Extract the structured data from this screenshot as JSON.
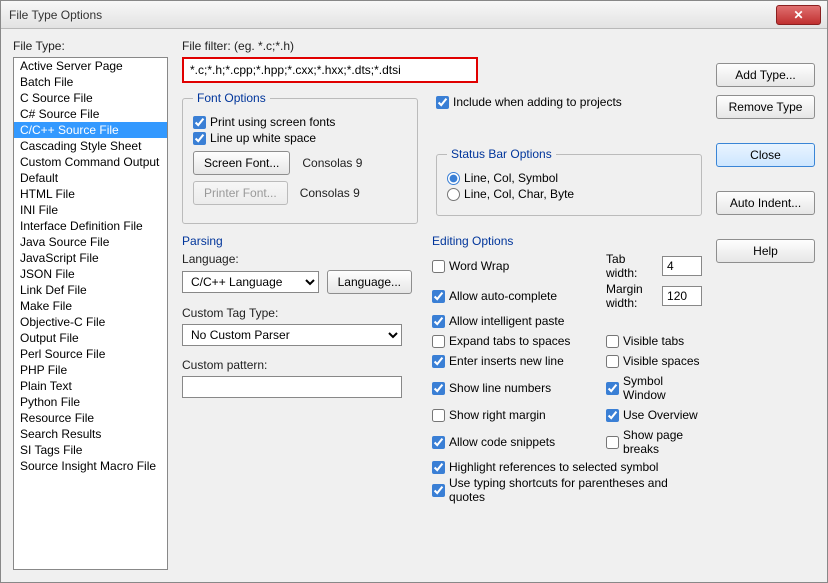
{
  "window": {
    "title": "File Type Options"
  },
  "left": {
    "label": "File Type:",
    "items": [
      "Active Server Page",
      "Batch File",
      "C Source File",
      "C# Source File",
      "C/C++ Source File",
      "Cascading Style Sheet",
      "Custom Command Output",
      "Default",
      "HTML File",
      "INI File",
      "Interface Definition File",
      "Java Source File",
      "JavaScript File",
      "JSON File",
      "Link Def File",
      "Make File",
      "Objective-C File",
      "Output File",
      "Perl Source File",
      "PHP File",
      "Plain Text",
      "Python File",
      "Resource File",
      "Search Results",
      "SI Tags File",
      "Source Insight Macro File"
    ],
    "selected_index": 4
  },
  "filter": {
    "label": "File filter: (eg. *.c;*.h)",
    "value": "*.c;*.h;*.cpp;*.hpp;*.cxx;*.hxx;*.dts;*.dtsi"
  },
  "font_options": {
    "title": "Font Options",
    "print_screen_fonts": {
      "label": "Print using screen fonts",
      "checked": true
    },
    "line_up_whitespace": {
      "label": "Line up white space",
      "checked": true
    },
    "screen_font_btn": "Screen Font...",
    "screen_font_name": "Consolas 9",
    "printer_font_btn": "Printer Font...",
    "printer_font_name": "Consolas 9"
  },
  "include_projects": {
    "label": "Include when adding to projects",
    "checked": true
  },
  "status_bar": {
    "title": "Status Bar Options",
    "opt1": "Line, Col, Symbol",
    "opt2": "Line, Col, Char, Byte",
    "selected": 0
  },
  "parsing": {
    "title": "Parsing",
    "language_label": "Language:",
    "language_value": "C/C++ Language",
    "language_btn": "Language...",
    "custom_tag_label": "Custom Tag Type:",
    "custom_tag_value": "No Custom Parser",
    "custom_pattern_label": "Custom pattern:",
    "custom_pattern_value": ""
  },
  "editing": {
    "title": "Editing Options",
    "word_wrap": {
      "label": "Word Wrap",
      "checked": false
    },
    "auto_complete": {
      "label": "Allow auto-complete",
      "checked": true
    },
    "intelligent_paste": {
      "label": "Allow intelligent paste",
      "checked": true
    },
    "expand_tabs": {
      "label": "Expand tabs to spaces",
      "checked": false
    },
    "enter_new_line": {
      "label": "Enter inserts new line",
      "checked": true
    },
    "line_numbers": {
      "label": "Show line numbers",
      "checked": true
    },
    "right_margin": {
      "label": "Show right margin",
      "checked": false
    },
    "code_snippets": {
      "label": "Allow code snippets",
      "checked": true
    },
    "highlight_refs": {
      "label": "Highlight references to selected symbol",
      "checked": true
    },
    "typing_shortcuts": {
      "label": "Use typing shortcuts for parentheses and quotes",
      "checked": true
    },
    "tab_width_label": "Tab width:",
    "tab_width": "4",
    "margin_width_label": "Margin width:",
    "margin_width": "120",
    "visible_tabs": {
      "label": "Visible tabs",
      "checked": false
    },
    "visible_spaces": {
      "label": "Visible spaces",
      "checked": false
    },
    "symbol_window": {
      "label": "Symbol Window",
      "checked": true
    },
    "use_overview": {
      "label": "Use Overview",
      "checked": true
    },
    "page_breaks": {
      "label": "Show page breaks",
      "checked": false
    }
  },
  "right_buttons": {
    "add_type": "Add Type...",
    "remove_type": "Remove Type",
    "close": "Close",
    "auto_indent": "Auto Indent...",
    "help": "Help"
  }
}
